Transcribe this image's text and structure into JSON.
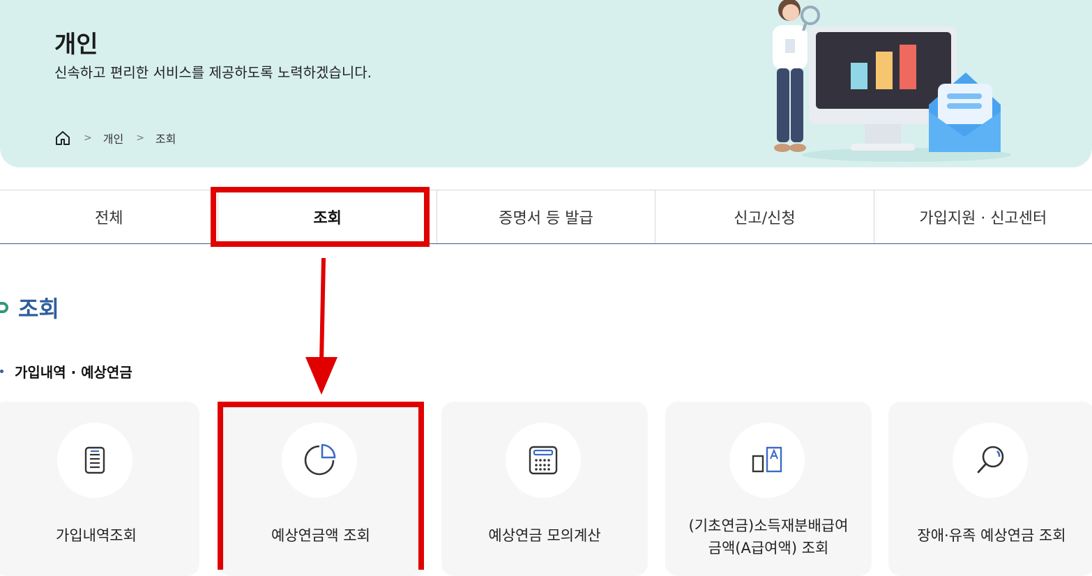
{
  "hero": {
    "title": "개인",
    "subtitle": "신속하고 편리한 서비스를 제공하도록 노력하겠습니다."
  },
  "breadcrumb": {
    "home_icon": "home-icon",
    "items": [
      "개인",
      "조회"
    ],
    "separator": ">"
  },
  "tabs": [
    {
      "label": "전체",
      "active": false
    },
    {
      "label": "조회",
      "active": true
    },
    {
      "label": "증명서 등 발급",
      "active": false
    },
    {
      "label": "신고/신청",
      "active": false
    },
    {
      "label": "가입지원 · 신고센터",
      "active": false
    }
  ],
  "section": {
    "title": "조회",
    "subsection": "가입내역 · 예상연금"
  },
  "cards": [
    {
      "label": "가입내역조회",
      "icon": "document-icon"
    },
    {
      "label": "예상연금액 조회",
      "icon": "pie-chart-icon"
    },
    {
      "label": "예상연금 모의계산",
      "icon": "calculator-icon"
    },
    {
      "label_line1": "(기초연금)소득재분배급여",
      "label_line2": "금액(A급여액) 조회",
      "icon": "a-value-icon"
    },
    {
      "label": "장애·유족 예상연금 조회",
      "icon": "search-icon"
    }
  ],
  "colors": {
    "hero_bg": "#d7f0ee",
    "accent_blue": "#2f5e9e",
    "highlight_red": "#e00000",
    "card_bg": "#f6f6f6"
  }
}
